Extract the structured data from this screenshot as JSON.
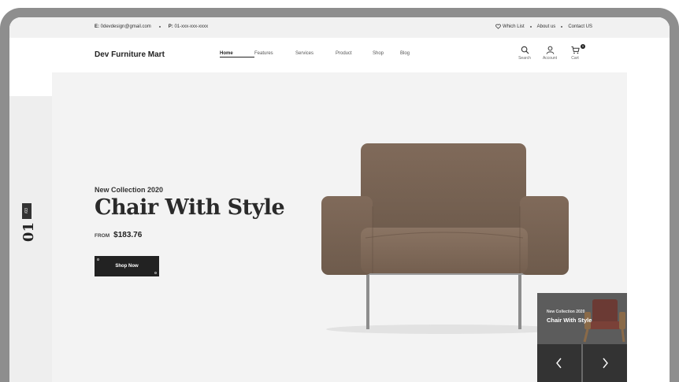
{
  "topbar": {
    "email_prefix": "E:",
    "email": "0devdesign@gmail.com",
    "phone_prefix": "P:",
    "phone": "01-xxx-xxx-xxxx",
    "wishlist": "Which List",
    "about": "About us",
    "contact": "Contact US"
  },
  "header": {
    "logo": "Dev Furniture Mart",
    "nav": [
      "Home",
      "Features",
      "Services",
      "Product",
      "Shop",
      "Blog"
    ],
    "icons": [
      {
        "icon": "search-icon",
        "label": "Search"
      },
      {
        "icon": "user-icon",
        "label": "Account"
      },
      {
        "icon": "cart-icon",
        "label": "Cart"
      }
    ],
    "cart_count": "0"
  },
  "slider": {
    "current": "01",
    "total": "/03"
  },
  "hero": {
    "eyebrow": "New Collection 2020",
    "headline": "Chair With Style",
    "from_label": "FROM",
    "price": "$183.76",
    "button": "Shop Now"
  },
  "mini_card": {
    "eyebrow": "New Collection 2020",
    "title": "Chair With Style"
  },
  "colors": {
    "chair": "#7a6656",
    "accent_dark": "#222222",
    "hero_bg": "#f3f3f3"
  }
}
